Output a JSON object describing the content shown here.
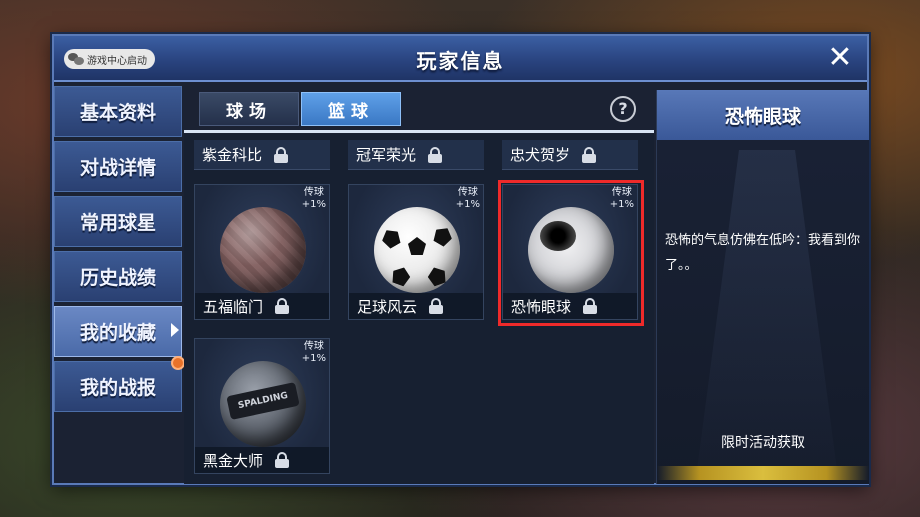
{
  "dialog": {
    "title": "玩家信息",
    "wechat_badge": "游戏中心启动",
    "close_label": "✕"
  },
  "side_nav": [
    {
      "label": "基本资料",
      "active": false
    },
    {
      "label": "对战详情",
      "active": false
    },
    {
      "label": "常用球星",
      "active": false
    },
    {
      "label": "历史战绩",
      "active": false
    },
    {
      "label": "我的收藏",
      "active": true
    },
    {
      "label": "我的战报",
      "active": false,
      "has_notice": true
    }
  ],
  "tabs": [
    {
      "label": "球场",
      "active": false
    },
    {
      "label": "篮球",
      "active": true
    }
  ],
  "help_label": "?",
  "collection": {
    "partial_row": [
      {
        "name": "紫金科比",
        "locked": true
      },
      {
        "name": "冠军荣光",
        "locked": true
      },
      {
        "name": "忠犬贺岁",
        "locked": true
      }
    ],
    "cards": [
      {
        "name": "五福临门",
        "tag_line1": "传球",
        "tag_line2": "+1%",
        "locked": true,
        "ball": "fortune"
      },
      {
        "name": "足球风云",
        "tag_line1": "传球",
        "tag_line2": "+1%",
        "locked": true,
        "ball": "soccer"
      },
      {
        "name": "恐怖眼球",
        "tag_line1": "传球",
        "tag_line2": "+1%",
        "locked": true,
        "ball": "eye",
        "selected": true
      },
      {
        "name": "黑金大师",
        "tag_line1": "传球",
        "tag_line2": "+1%",
        "locked": true,
        "ball": "spalding",
        "ball_text": "SPALDING"
      }
    ]
  },
  "detail": {
    "title": "恐怖眼球",
    "description": "恐怖的气息仿佛在低吟：我看到你了。。",
    "source": "限时活动获取"
  },
  "colors": {
    "selection_border": "#ef2a2a",
    "active_tab": "#3a78c4",
    "title_bar": "#2a4480"
  }
}
